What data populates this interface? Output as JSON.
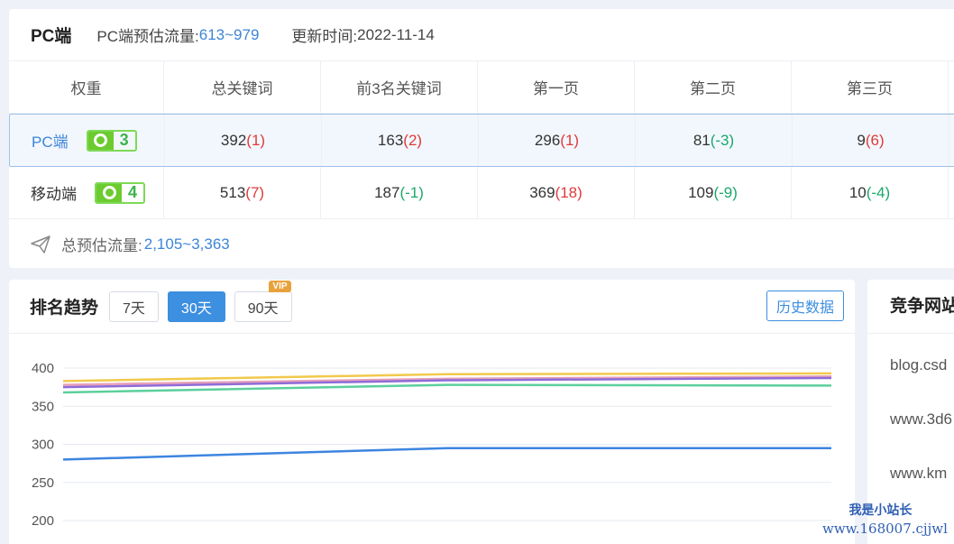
{
  "header": {
    "title": "PC端",
    "traffic_label": "PC端预估流量:",
    "traffic_value": "613~979",
    "update_label": "更新时间:",
    "update_value": "2022-11-14"
  },
  "table": {
    "columns": [
      "权重",
      "总关键词",
      "前3名关键词",
      "第一页",
      "第二页",
      "第三页"
    ],
    "rows": [
      {
        "label": "PC端",
        "badge": "3",
        "cells": [
          {
            "value": "392",
            "delta": "(1)",
            "dir": "up"
          },
          {
            "value": "163",
            "delta": "(2)",
            "dir": "up"
          },
          {
            "value": "296",
            "delta": "(1)",
            "dir": "up"
          },
          {
            "value": "81",
            "delta": "(-3)",
            "dir": "down"
          },
          {
            "value": "9",
            "delta": "(6)",
            "dir": "up"
          }
        ]
      },
      {
        "label": "移动端",
        "badge": "4",
        "cells": [
          {
            "value": "513",
            "delta": "(7)",
            "dir": "up"
          },
          {
            "value": "187",
            "delta": "(-1)",
            "dir": "down"
          },
          {
            "value": "369",
            "delta": "(18)",
            "dir": "up"
          },
          {
            "value": "109",
            "delta": "(-9)",
            "dir": "down"
          },
          {
            "value": "10",
            "delta": "(-4)",
            "dir": "down"
          }
        ]
      }
    ]
  },
  "total": {
    "label": "总预估流量:",
    "value": "2,105~3,363"
  },
  "trend": {
    "title": "排名趋势",
    "ranges": [
      "7天",
      "30天",
      "90天"
    ],
    "active_range": "30天",
    "vip_label": "VIP",
    "history_button": "历史数据"
  },
  "competitors": {
    "title": "竞争网站",
    "items": [
      "blog.csd",
      "www.3d6",
      "www.km"
    ]
  },
  "watermark": {
    "line1": "我是小站长",
    "line2": "www.168007.cjjwl"
  },
  "colors": {
    "accent": "#3d8fe0",
    "increase": "#e03a3a",
    "decrease": "#1aa86b",
    "badge": "#6ccb2f"
  },
  "chart_data": {
    "type": "line",
    "ylim": [
      200,
      400
    ],
    "yticks": [
      "400",
      "350",
      "300",
      "250",
      "200"
    ],
    "x": [
      0,
      1,
      2
    ],
    "series": [
      {
        "color": "#f2c94c",
        "values": [
          383,
          392,
          393
        ]
      },
      {
        "color": "#e8a0b8",
        "values": [
          378,
          386,
          389
        ]
      },
      {
        "color": "#8e6cd8",
        "values": [
          375,
          384,
          387
        ]
      },
      {
        "color": "#5ccf9c",
        "values": [
          368,
          378,
          377
        ]
      },
      {
        "color": "#3d85e0",
        "values": [
          280,
          295,
          295
        ]
      }
    ]
  }
}
